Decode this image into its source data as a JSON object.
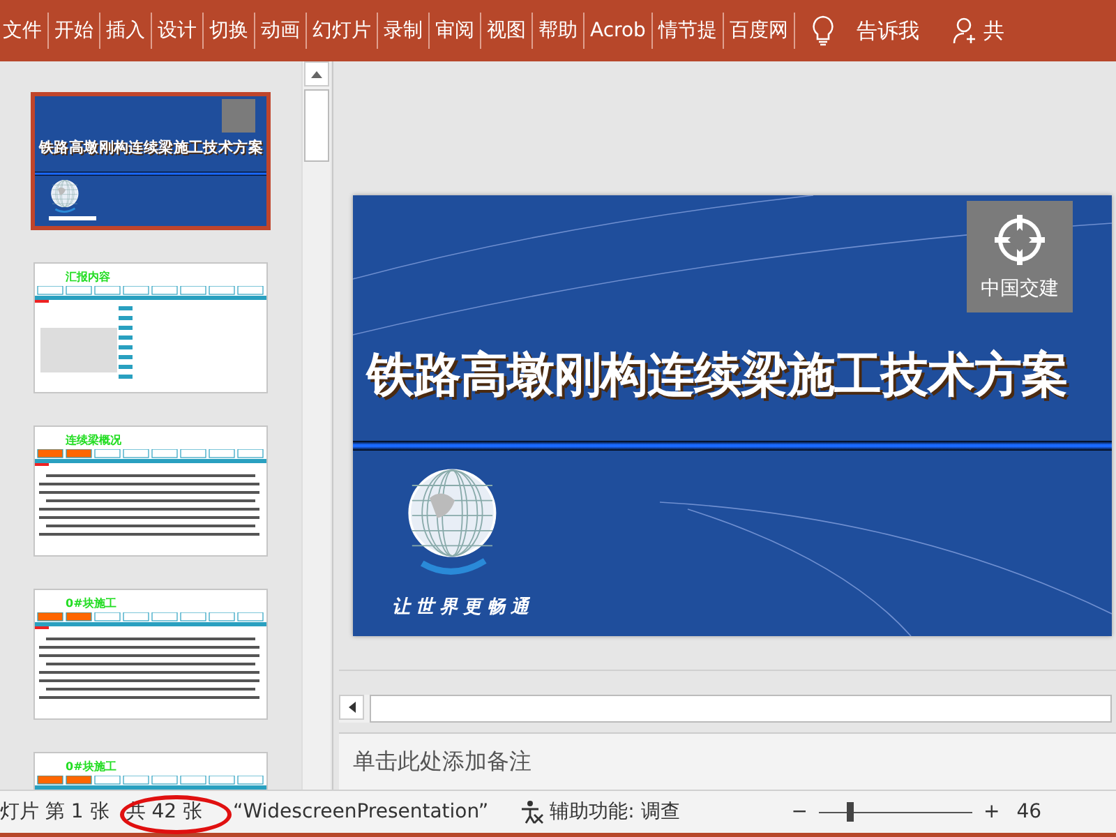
{
  "ribbon": {
    "tabs": [
      "文件",
      "开始",
      "插入",
      "设计",
      "切换",
      "动画",
      "幻灯片",
      "录制",
      "审阅",
      "视图",
      "帮助",
      "Acrob",
      "情节提",
      "百度网"
    ],
    "tell_me": "告诉我",
    "share": "共"
  },
  "slides": [
    {
      "kind": "title",
      "selected": true,
      "title": "铁路高墩刚构连续梁施工技术方案"
    },
    {
      "kind": "content",
      "selected": false,
      "heading": "汇报内容",
      "photo": true
    },
    {
      "kind": "content",
      "selected": false,
      "heading": "连续梁概况",
      "photo": false
    },
    {
      "kind": "content",
      "selected": false,
      "heading": "0#块施工",
      "photo": false
    },
    {
      "kind": "content",
      "selected": false,
      "heading": "0#块施工",
      "photo": false
    }
  ],
  "editor": {
    "title": "铁路高墩刚构连续梁施工技术方案",
    "slogan": "让世界更畅通",
    "logo_text": "中国交建"
  },
  "notes": {
    "placeholder": "单击此处添加备注"
  },
  "status_bar": {
    "slide_position": "灯片 第 1 张",
    "slide_count": "共 42 张",
    "theme": "“WidescreenPresentation”",
    "accessibility": "辅助功能: 调查",
    "zoom_minus": "−",
    "zoom_plus": "+",
    "zoom_slider": {
      "level": 0.18
    },
    "zoom_value": "46"
  }
}
